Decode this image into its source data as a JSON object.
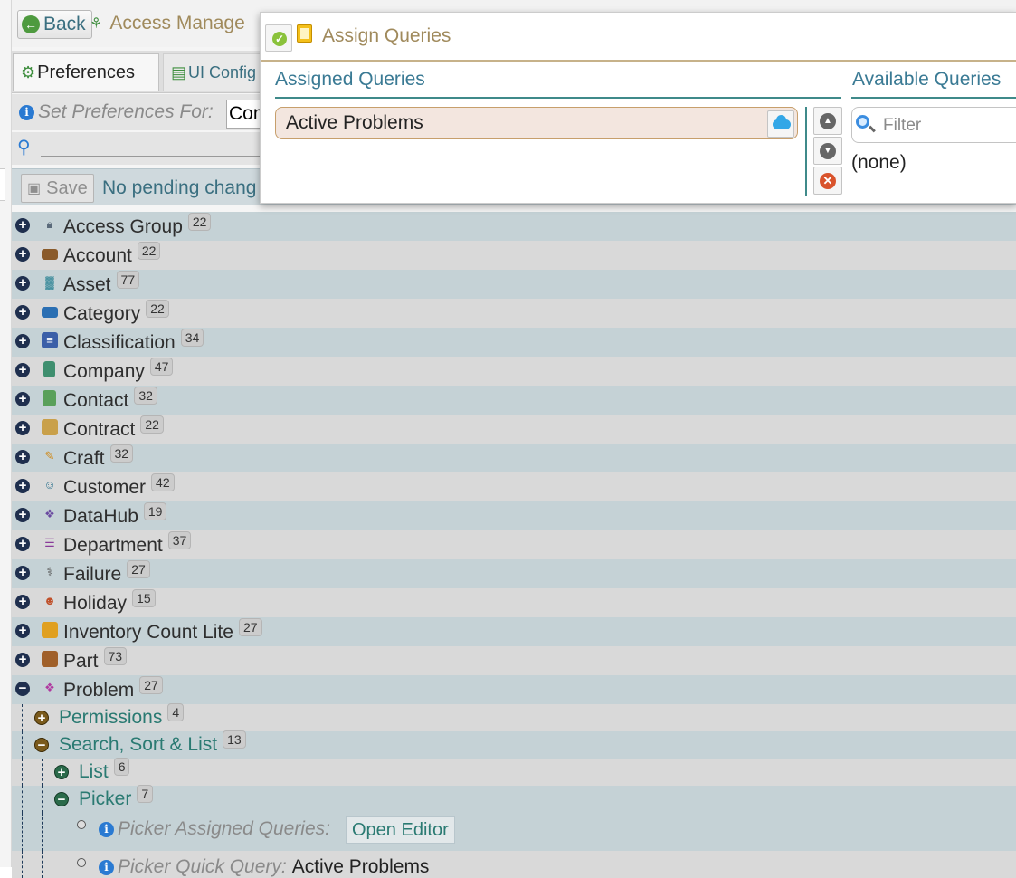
{
  "header": {
    "back_label": "Back",
    "title": "Access Manage"
  },
  "tabs": [
    {
      "label": "Preferences",
      "active": true
    },
    {
      "label": "UI Config",
      "active": false
    }
  ],
  "preferences": {
    "set_for_label": "Set Preferences For:",
    "set_for_value": "Com"
  },
  "save_bar": {
    "save_label": "Save",
    "status": "No pending chang"
  },
  "tree": {
    "entities": [
      {
        "label": "Access Group",
        "count": "22",
        "icon": "access-group-icon"
      },
      {
        "label": "Account",
        "count": "22",
        "icon": "wallet-icon"
      },
      {
        "label": "Asset",
        "count": "77",
        "icon": "asset-icon"
      },
      {
        "label": "Category",
        "count": "22",
        "icon": "folder-icon"
      },
      {
        "label": "Classification",
        "count": "34",
        "icon": "classification-icon"
      },
      {
        "label": "Company",
        "count": "47",
        "icon": "building-icon"
      },
      {
        "label": "Contact",
        "count": "32",
        "icon": "contact-card-icon"
      },
      {
        "label": "Contract",
        "count": "22",
        "icon": "scroll-icon"
      },
      {
        "label": "Craft",
        "count": "32",
        "icon": "pencil-icon"
      },
      {
        "label": "Customer",
        "count": "42",
        "icon": "customer-icon"
      },
      {
        "label": "DataHub",
        "count": "19",
        "icon": "datahub-icon"
      },
      {
        "label": "Department",
        "count": "37",
        "icon": "org-chart-icon"
      },
      {
        "label": "Failure",
        "count": "27",
        "icon": "failure-icon"
      },
      {
        "label": "Holiday",
        "count": "15",
        "icon": "holiday-icon"
      },
      {
        "label": "Inventory Count Lite",
        "count": "27",
        "icon": "inventory-icon"
      },
      {
        "label": "Part",
        "count": "73",
        "icon": "box-icon"
      },
      {
        "label": "Problem",
        "count": "27",
        "icon": "puzzle-icon"
      }
    ],
    "problem_children": [
      {
        "label": "Permissions",
        "count": "4"
      },
      {
        "label": "Search, Sort & List",
        "count": "13"
      }
    ],
    "search_children": [
      {
        "label": "List",
        "count": "6"
      },
      {
        "label": "Picker",
        "count": "7"
      }
    ],
    "picker_settings": {
      "assigned_queries_label": "Picker Assigned Queries:",
      "open_editor_label": "Open Editor",
      "quick_query_label": "Picker Quick Query:",
      "quick_query_value": "Active Problems"
    }
  },
  "dialog": {
    "title": "Assign Queries",
    "assigned_heading": "Assigned Queries",
    "available_heading": "Available Queries",
    "assigned_items": [
      "Active Problems"
    ],
    "filter_placeholder": "Filter",
    "available_empty": "(none)"
  },
  "colors": {
    "accent": "#3a7a94",
    "title_gold": "#a08a5c",
    "row_teal": "#c5d2d6",
    "row_gray": "#d9d9d9"
  }
}
